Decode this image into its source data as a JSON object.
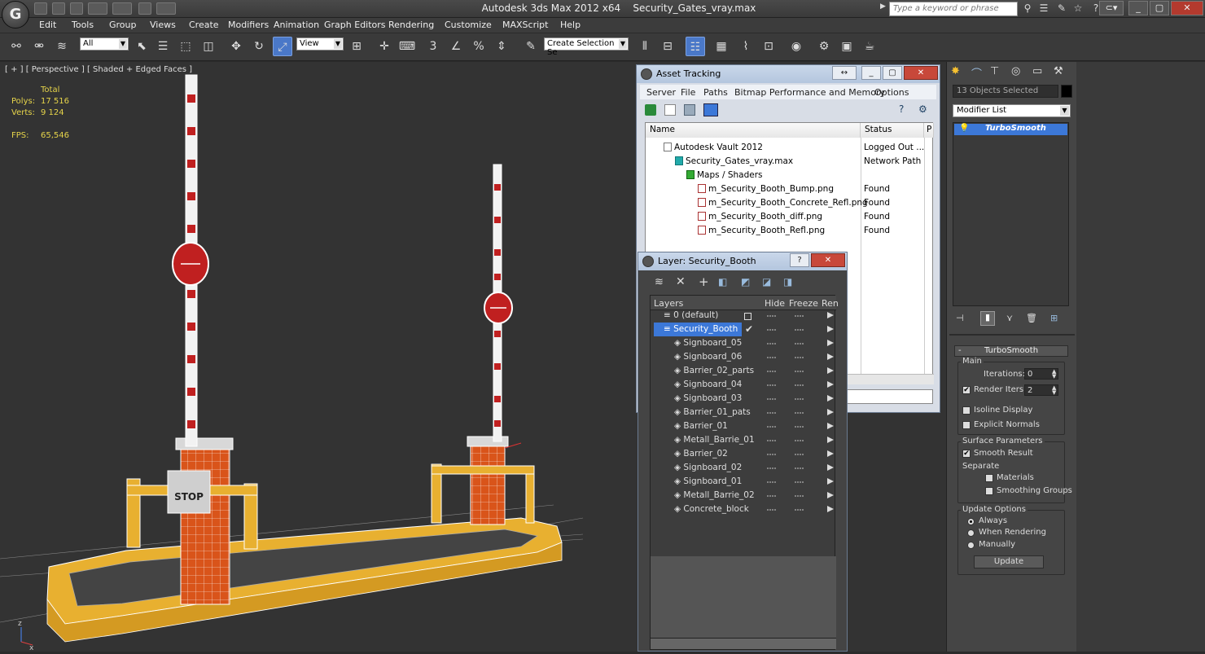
{
  "app": {
    "title": "Autodesk 3ds Max  2012 x64",
    "filename": "Security_Gates_vray.max",
    "search_placeholder": "Type a keyword or phrase"
  },
  "menu": [
    "Edit",
    "Tools",
    "Group",
    "Views",
    "Create",
    "Modifiers",
    "Animation",
    "Graph Editors",
    "Rendering",
    "Customize",
    "MAXScript",
    "Help"
  ],
  "toolbar": {
    "selection_filter": "All",
    "coord_system": "View",
    "named_selection": "Create Selection Se",
    "snap_labels": [
      "3",
      "%"
    ]
  },
  "viewport": {
    "label": "[ + ] [ Perspective ] [ Shaded + Edged Faces ]",
    "stats": {
      "total_label": "Total",
      "polys_label": "Polys:",
      "polys_value": "17 516",
      "verts_label": "Verts:",
      "verts_value": "9 124",
      "fps_label": "FPS:",
      "fps_value": "65,546"
    },
    "sign_text": "STOP",
    "axis": {
      "z": "z",
      "x": "x"
    }
  },
  "asset_tracking": {
    "title": "Asset Tracking",
    "menus": [
      "Server",
      "File",
      "Paths",
      "Bitmap Performance and Memory",
      "Options"
    ],
    "columns": [
      "Name",
      "Status",
      "P"
    ],
    "rows": [
      {
        "name": "Autodesk Vault 2012",
        "status": "Logged Out ..."
      },
      {
        "name": "Security_Gates_vray.max",
        "status": "Network Path"
      },
      {
        "name": "Maps / Shaders",
        "status": ""
      },
      {
        "name": "m_Security_Booth_Bump.png",
        "status": "Found"
      },
      {
        "name": "m_Security_Booth_Concrete_Refl.png",
        "status": "Found"
      },
      {
        "name": "m_Security_Booth_diff.png",
        "status": "Found"
      },
      {
        "name": "m_Security_Booth_Refl.png",
        "status": "Found"
      }
    ]
  },
  "layer_dialog": {
    "title": "Layer: Security_Booth",
    "help": "?",
    "columns": [
      "Layers",
      "Hide",
      "Freeze",
      "Ren"
    ],
    "layers": [
      {
        "name": "0 (default)"
      },
      {
        "name": "Security_Booth"
      },
      {
        "name": "Signboard_05"
      },
      {
        "name": "Signboard_06"
      },
      {
        "name": "Barrier_02_parts"
      },
      {
        "name": "Signboard_04"
      },
      {
        "name": "Signboard_03"
      },
      {
        "name": "Barrier_01_pats"
      },
      {
        "name": "Barrier_01"
      },
      {
        "name": "Metall_Barrie_01"
      },
      {
        "name": "Barrier_02"
      },
      {
        "name": "Signboard_02"
      },
      {
        "name": "Signboard_01"
      },
      {
        "name": "Metall_Barrie_02"
      },
      {
        "name": "Concrete_block"
      }
    ],
    "dash": "----"
  },
  "command_panel": {
    "selection_info": "13 Objects Selected",
    "modifier_list": "Modifier List",
    "stack_item": "TurboSmooth",
    "rollout_title": "TurboSmooth",
    "main_label": "Main",
    "iterations_label": "Iterations:",
    "iterations_value": "0",
    "render_iters_label": "Render Iters:",
    "render_iters_value": "2",
    "isoline_label": "Isoline Display",
    "explicit_normals_label": "Explicit Normals",
    "surface_params_label": "Surface Parameters",
    "smooth_result_label": "Smooth Result",
    "separate_label": "Separate",
    "materials_label": "Materials",
    "smoothing_groups_label": "Smoothing Groups",
    "update_options_label": "Update Options",
    "always_label": "Always",
    "when_rendering_label": "When Rendering",
    "manually_label": "Manually",
    "update_button": "Update",
    "collapse_glyph": "-"
  },
  "colors": {
    "accent": "#4a78c8",
    "selection": "#3c78d8",
    "viewport_bg": "#333333",
    "stat_text": "#e6d44a",
    "wire_white": "#ffffff",
    "booth_orange": "#d9541a",
    "concrete_yellow": "#e8b030"
  }
}
